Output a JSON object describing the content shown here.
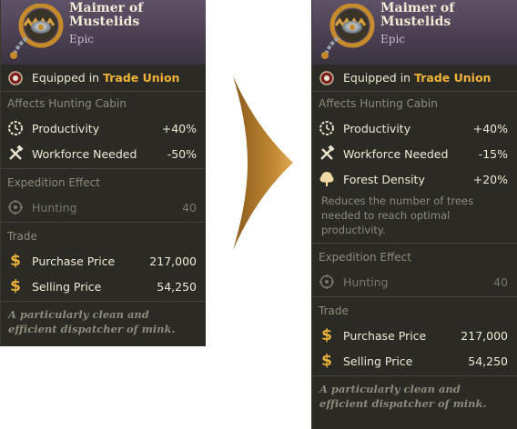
{
  "left": {
    "title": "Maimer of Mustelids",
    "rarity": "Epic",
    "equipped_prefix": "Equipped in",
    "equipped_location": "Trade Union",
    "affects_title": "Affects Hunting Cabin",
    "stats": [
      {
        "label": "Productivity",
        "value": "+40%",
        "icon": "gear-clock-icon"
      },
      {
        "label": "Workforce Needed",
        "value": "-50%",
        "icon": "crossed-tools-icon"
      }
    ],
    "expedition_title": "Expedition Effect",
    "expedition": {
      "label": "Hunting",
      "value": "40",
      "icon": "crosshair-icon"
    },
    "trade_title": "Trade",
    "purchase": {
      "label": "Purchase Price",
      "value": "217,000",
      "icon": "dollar-icon"
    },
    "selling": {
      "label": "Selling Price",
      "value": "54,250",
      "icon": "dollar-icon"
    },
    "flavor_line1": "A particularly clean and",
    "flavor_line2": "efficient dispatcher of mink."
  },
  "right": {
    "title": "Maimer of Mustelids",
    "rarity": "Epic",
    "equipped_prefix": "Equipped in",
    "equipped_location": "Trade Union",
    "affects_title": "Affects Hunting Cabin",
    "stats": [
      {
        "label": "Productivity",
        "value": "+40%",
        "icon": "gear-clock-icon"
      },
      {
        "label": "Workforce Needed",
        "value": "-15%",
        "icon": "crossed-tools-icon"
      },
      {
        "label": "Forest Density",
        "value": "+20%",
        "icon": "tree-icon"
      }
    ],
    "description_line1": "Reduces the number of trees",
    "description_line2": "needed to reach optimal",
    "description_line3": "productivity.",
    "expedition_title": "Expedition Effect",
    "expedition": {
      "label": "Hunting",
      "value": "40",
      "icon": "crosshair-icon"
    },
    "trade_title": "Trade",
    "purchase": {
      "label": "Purchase Price",
      "value": "217,000",
      "icon": "dollar-icon"
    },
    "selling": {
      "label": "Selling Price",
      "value": "54,250",
      "icon": "dollar-icon"
    },
    "flavor_line1": "A particularly clean and",
    "flavor_line2": "efficient dispatcher of mink."
  },
  "colors": {
    "panel_bg": "#2b2a24",
    "header_bg": "#4b4052",
    "accent_gold": "#f2b33a",
    "muted_text": "#8e8a7d",
    "arrow": "#b07a2a"
  }
}
